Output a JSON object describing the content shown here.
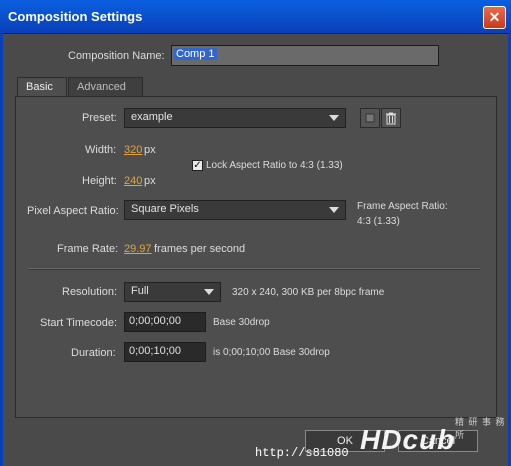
{
  "window": {
    "title": "Composition Settings",
    "close_glyph": "✕"
  },
  "comp_name": {
    "label": "Composition Name:",
    "value": "Comp 1"
  },
  "tabs": [
    {
      "label": "Basic"
    },
    {
      "label": "Advanced"
    }
  ],
  "preset": {
    "label": "Preset:",
    "value": "example"
  },
  "width": {
    "label": "Width:",
    "value": "320",
    "unit": "px"
  },
  "height": {
    "label": "Height:",
    "value": "240",
    "unit": "px"
  },
  "lock_aspect": {
    "label": "Lock Aspect Ratio to 4:3 (1.33)",
    "checked": true,
    "glyph": "✓"
  },
  "pixel_aspect": {
    "label": "Pixel Aspect Ratio:",
    "value": "Square Pixels"
  },
  "frame_aspect": {
    "label": "Frame Aspect Ratio:",
    "value": "4:3 (1.33)"
  },
  "frame_rate": {
    "label": "Frame Rate:",
    "value": "29.97",
    "unit": "frames per second"
  },
  "resolution": {
    "label": "Resolution:",
    "value": "Full",
    "info": "320 x 240, 300 KB per 8bpc frame"
  },
  "start_timecode": {
    "label": "Start Timecode:",
    "value": "0;00;00;00",
    "note": "Base 30drop"
  },
  "duration": {
    "label": "Duration:",
    "value": "0;00;10;00",
    "note": "is 0;00;10;00  Base 30drop"
  },
  "buttons": {
    "ok": "OK",
    "cancel": "Cancel"
  },
  "icons": {
    "save_preset": "save-icon",
    "delete_preset": "trash-icon"
  },
  "watermark": {
    "logo": "HDcub",
    "url": "http://s81080",
    "cjk": "精 研 事 務 所"
  }
}
